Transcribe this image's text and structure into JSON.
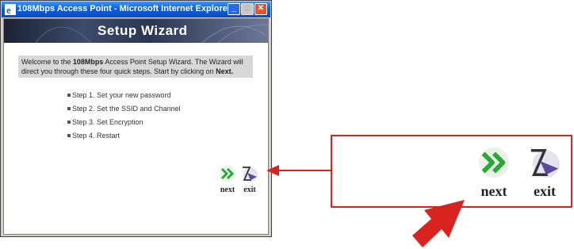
{
  "window": {
    "title": "108Mbps Access Point - Microsoft Internet Explorer",
    "controls": {
      "minimize": "_",
      "maximize": "□",
      "close": "✕"
    }
  },
  "banner": {
    "title": "Setup Wizard"
  },
  "welcome": {
    "prefix": "Welcome to the ",
    "brand": "108Mbps",
    "middle": " Access Point Setup Wizard. The Wizard will direct you through these four quick steps. Start by clicking on ",
    "next_word": "Next."
  },
  "steps": [
    "Step 1. Set your new password",
    "Step 2. Set the SSID and Channel",
    "Step 3. Set Encryption",
    "Step 4. Restart"
  ],
  "nav": {
    "next_label": "next",
    "exit_label": "exit"
  },
  "colors": {
    "callout_red": "#d9231f",
    "next_green": "#2aa63a",
    "exit_purple": "#5a4aa0"
  }
}
